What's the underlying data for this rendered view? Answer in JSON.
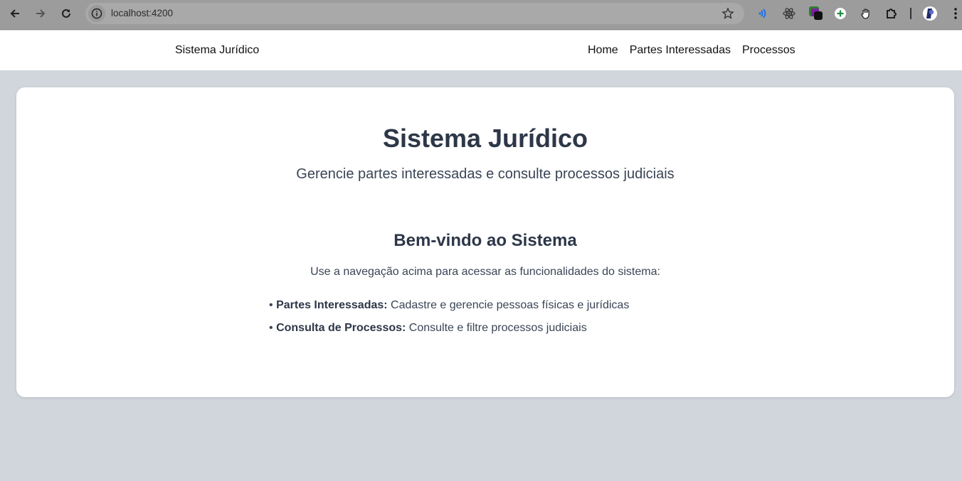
{
  "browser": {
    "url": "localhost:4200"
  },
  "header": {
    "brand": "Sistema Jurídico",
    "nav": [
      "Home",
      "Partes Interessadas",
      "Processos"
    ]
  },
  "main": {
    "title": "Sistema Jurídico",
    "subtitle": "Gerencie partes interessadas e consulte processos judiciais",
    "welcome_title": "Bem-vindo ao Sistema",
    "welcome_text": "Use a navegação acima para acessar as funcionalidades do sistema:",
    "features": [
      {
        "bullet": "•",
        "label": "Partes Interessadas:",
        "desc": "Cadastre e gerencie pessoas físicas e jurídicas"
      },
      {
        "bullet": "•",
        "label": "Consulta de Processos:",
        "desc": "Consulte e filtre processos judiciais"
      }
    ]
  },
  "icons": [
    "back-arrow-icon",
    "forward-arrow-icon",
    "reload-icon",
    "site-info-icon",
    "bookmark-star-icon",
    "broadcast-extension-icon",
    "react-extension-icon",
    "color-picker-extension-icon",
    "add-extension-icon",
    "hand-cursor-extension-icon",
    "puzzle-extensions-icon",
    "profile-avatar-icon",
    "kebab-menu-icon"
  ]
}
